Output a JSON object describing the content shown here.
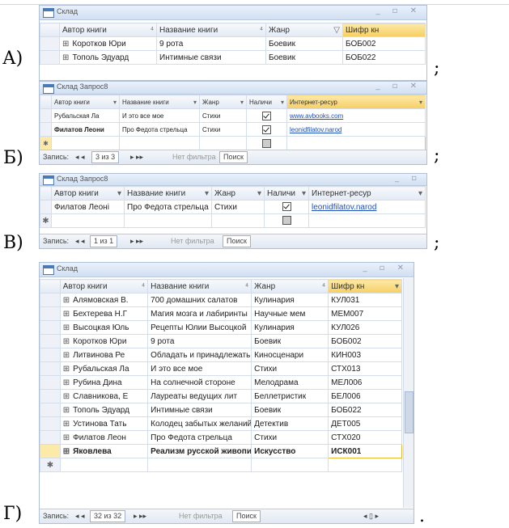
{
  "labels": {
    "a": "А)",
    "b": "Б)",
    "c": "В)",
    "d": "Г)",
    "semicolon": ";",
    "period": "."
  },
  "colors": {
    "accent_header": "#f6cf63",
    "link": "#1f4fb8"
  },
  "win_a": {
    "title": "Склад",
    "controls": "_ ▫ ✕",
    "headers": [
      "Автор книги",
      "Название книги",
      "Жанр",
      "Шифр кн"
    ],
    "rows": [
      [
        "Коротков Юри",
        "9 рота",
        "Боевик",
        "БОБ002"
      ],
      [
        "Тополь Эдуард",
        "Интимные связи",
        "Боевик",
        "БОБ022"
      ]
    ]
  },
  "win_b": {
    "title": "Склад Запрос8",
    "controls": "_ ▫ ✕",
    "headers": [
      "Автор книги",
      "Название книги",
      "Жанр",
      "Наличи",
      "Интернет-ресур"
    ],
    "rows": [
      [
        "Рубальская Ла",
        "И это все мое",
        "Стихи",
        "www.avbooks.com"
      ],
      [
        "Филатов Леони",
        "Про Федота стрельца",
        "Стихи",
        "leonidfilatov.narod"
      ]
    ],
    "nav": {
      "prefix": "Запись:",
      "pos": "3 из 3",
      "filter": "Нет фильтра",
      "search": "Поиск"
    }
  },
  "win_c": {
    "title": "Склад Запрос8",
    "controls": "_ ▫",
    "headers": [
      "Автор книги",
      "Название книги",
      "Жанр",
      "Наличи",
      "Интернет-ресур"
    ],
    "rows": [
      [
        "Филатов Леоні",
        "Про Федота стрельца",
        "Стихи",
        "leonidfilatov.narod"
      ]
    ],
    "nav": {
      "prefix": "Запись:",
      "pos": "1 из 1",
      "filter": "Нет фильтра",
      "search": "Поиск"
    }
  },
  "win_d": {
    "title": "Склад",
    "controls": "_ ▫ ✕",
    "headers": [
      "Автор книги",
      "Название книги",
      "Жанр",
      "Шифр кн"
    ],
    "rows": [
      [
        "Алямовская В.",
        "700 домашних салатов",
        "Кулинария",
        "КУЛ031"
      ],
      [
        "Бехтерева Н.Г",
        "Магия мозга и лабиринты",
        "Научные мем",
        "МЕМ007"
      ],
      [
        "Высоцкая Юль",
        "Рецепты Юлии Высоцкой",
        "Кулинария",
        "КУЛ026"
      ],
      [
        "Коротков Юри",
        "9 рота",
        "Боевик",
        "БОБ002"
      ],
      [
        "Литвинова Ре",
        "Обладать и принадлежать",
        "Киносценари",
        "КИН003"
      ],
      [
        "Рубальская Ла",
        "И это все мое",
        "Стихи",
        "СТХ013"
      ],
      [
        "Рубина Дина",
        "На солнечной стороне",
        "Мелодрама",
        "МЕЛ006"
      ],
      [
        "Славникова, Е",
        "Лауреаты ведущих лит",
        "Беллетристик",
        "БЕЛ006"
      ],
      [
        "Тополь Эдуард",
        "Интимные связи",
        "Боевик",
        "БОБ022"
      ],
      [
        "Устинова Тать",
        "Колодец забытых желаний",
        "Детектив",
        "ДЕТ005"
      ],
      [
        "Филатов Леон",
        "Про Федота стрельца",
        "Стихи",
        "СТХ020"
      ],
      [
        "Яковлева",
        "Реализм русской живописи",
        "Искусство",
        "ИСК001"
      ]
    ],
    "nav": {
      "prefix": "Запись:",
      "pos": "32 из 32",
      "filter": "Нет фильтра",
      "search": "Поиск"
    }
  }
}
